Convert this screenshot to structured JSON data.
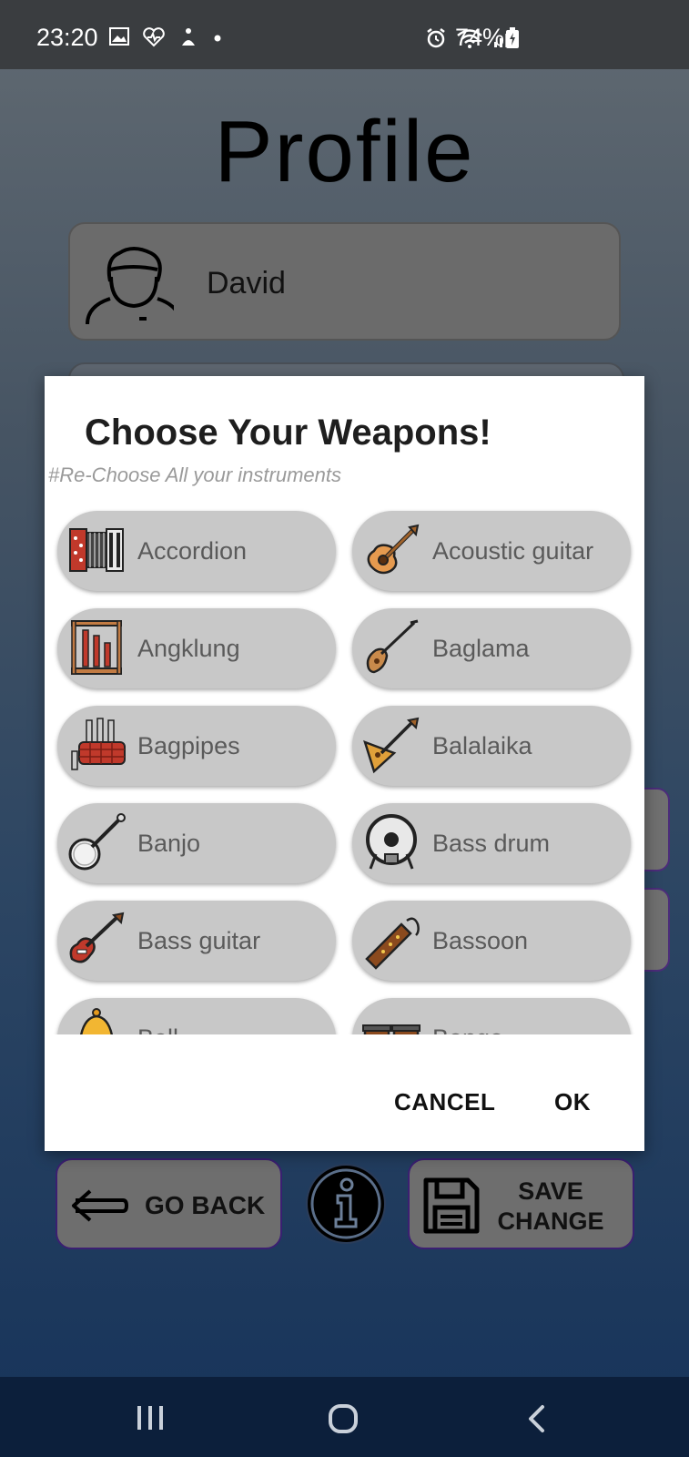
{
  "status_bar": {
    "time": "23:20",
    "battery": "74%"
  },
  "page": {
    "title": "Profile",
    "user_name": "David"
  },
  "dialog": {
    "title": "Choose Your Weapons!",
    "subtitle": "#Re-Choose All your instruments",
    "instruments": [
      {
        "label": "Accordion",
        "icon": "accordion-icon"
      },
      {
        "label": "Acoustic guitar",
        "icon": "acoustic-guitar-icon"
      },
      {
        "label": "Angklung",
        "icon": "angklung-icon"
      },
      {
        "label": "Baglama",
        "icon": "baglama-icon"
      },
      {
        "label": "Bagpipes",
        "icon": "bagpipes-icon"
      },
      {
        "label": "Balalaika",
        "icon": "balalaika-icon"
      },
      {
        "label": "Banjo",
        "icon": "banjo-icon"
      },
      {
        "label": "Bass drum",
        "icon": "bass-drum-icon"
      },
      {
        "label": "Bass guitar",
        "icon": "bass-guitar-icon"
      },
      {
        "label": "Bassoon",
        "icon": "bassoon-icon"
      },
      {
        "label": "Bell",
        "icon": "bell-icon"
      },
      {
        "label": "Bongo",
        "icon": "bongo-icon"
      }
    ],
    "cancel_label": "CANCEL",
    "ok_label": "OK"
  },
  "bottom_actions": {
    "back_label": "GO BACK",
    "save_label": "SAVE CHANGE"
  }
}
